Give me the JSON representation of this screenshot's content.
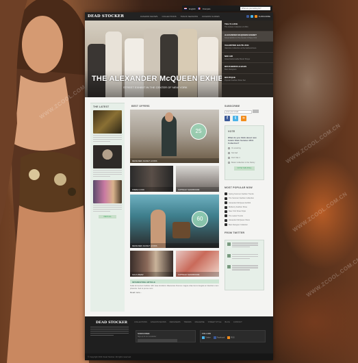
{
  "topbar": {
    "lang_en": "English",
    "lang_fr": "Français",
    "search_placeholder": "What are you looking for?"
  },
  "header": {
    "logo": "DEAD STOCKER",
    "nav": [
      "FASHION SHOWS",
      "COLLECTIONS",
      "TRACK SEASONS",
      "FASHION GUIDES",
      "MODELS"
    ],
    "subscribe": "SUBSCRIBE"
  },
  "hero": {
    "title": "THE ALEXANDER McQUEEN EXHIBIT",
    "subtitle": "STREET EXHIBIT IN THE CENTER OF NEW YORK",
    "side": [
      {
        "title": "TELL'S LOVE",
        "text": "The Hottest Collection of 2011"
      },
      {
        "title": "ALEXANDER McQUEEN EXHIBIT",
        "text": "Street Exhibit In The Center Of New York"
      },
      {
        "title": "VALENTINO HAUTE 2011",
        "text": "Valentino Collection at the fashionshows"
      },
      {
        "title": "NIKI AIR",
        "text": "Great Fashionable Brand Shops"
      },
      {
        "title": "BOUCHERON & BAGS",
        "text": "Best Designers"
      },
      {
        "title": "BOUTIQUE",
        "text": "Popular Fashion Show Set"
      }
    ]
  },
  "left": {
    "title": "THE LATEST",
    "button": "VIEW ALL"
  },
  "middle": {
    "title": "BEST OFFERS",
    "offers": [
      {
        "badge": "25",
        "label": "DESIGNER JACKET LOOKS"
      },
      {
        "label": "FRESH LOOK"
      },
      {
        "label": "CATWALK SHOWROOM"
      },
      {
        "badge": "60",
        "label": "DESIGNER JACKET LOOKS"
      },
      {
        "label": "GALA WEAR"
      },
      {
        "label": "CATWALK SHOWROOM"
      }
    ],
    "interesting_title": "INTERESTING ARTICLE",
    "interesting_text": "Nulla fermentum facilisis nibh vitae tincidunt. Maecenas rhoncus magna vitae lorem feugiat ac interdum nunc pharetra. Sed ut purus nunc.",
    "read_more": "Read more..."
  },
  "right": {
    "subscribe_title": "SUBSCRIBE",
    "subscribe_placeholder": "enter your email",
    "vote_title": "VOTE",
    "vote_question": "What do you think about new Calvin Klein Summer 2011 Collection?",
    "vote_options": [
      "It's amazing",
      "Not bad",
      "Don't like it",
      "Better Collection in the history"
    ],
    "vote_button": "VOTE THIS POLL",
    "popular_title": "MOST POPULAR NOW",
    "popular": [
      "Spring Summer Fashion Trends",
      "The Summer Fashion Collection",
      "Alexander McQueen Exhibit",
      "Mulberry Fashion Show",
      "New York Street Style",
      "The Latest Trends",
      "Alexander McQueen Show",
      "Best Designer Collection"
    ],
    "twitter_title": "FROM TWITTER"
  },
  "footer": {
    "logo": "DEAD STOCKER",
    "links": [
      "COLLECTIONS",
      "FASHION SHOWS",
      "DESIGNERS",
      "TRENDS",
      "MAGAZINE",
      "STREET STYLE",
      "BLOG",
      "CONTACT"
    ],
    "box1_title": "SUBSCRIBE",
    "box1_text": "Sign up for our newsletter",
    "box2_title": "FOLLOW",
    "social": [
      "Twitter",
      "Facebook",
      "RSS"
    ],
    "copyright": "© Copyright 2011 Dead Stocker. All rights reserved."
  },
  "watermark": "WWW.ZCOOL.COM.CN",
  "colors": {
    "accent": "#c7dfc9",
    "panel": "#e6efe8",
    "dark": "#222222",
    "facebook": "#3b5998",
    "twitter": "#4ab3e8",
    "rss": "#f28c1c"
  }
}
